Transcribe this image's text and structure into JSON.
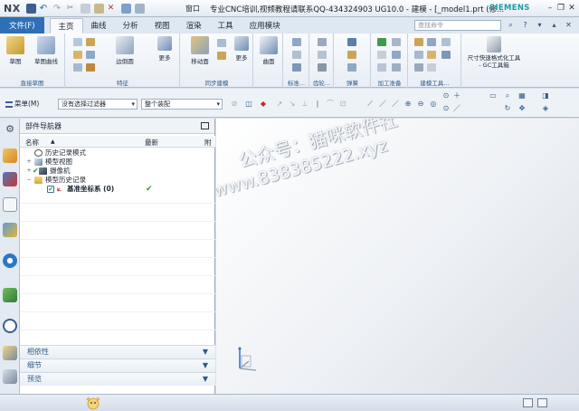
{
  "titlebar": {
    "logo": "NX",
    "window_menu": "窗口",
    "title": "专业CNC培训,视频教程请联系QQ-434324903 UG10.0 - 建模 - [_model1.prt  (修...",
    "brand": "SIEMENS"
  },
  "tabs": {
    "file": "文件(F)",
    "items": [
      "主页",
      "曲线",
      "分析",
      "视图",
      "渲染",
      "工具",
      "应用模块"
    ],
    "active": "主页",
    "search_placeholder": "查找命令"
  },
  "ribbon": {
    "groups": [
      {
        "label": "直接草图",
        "buttons": [
          "草图",
          "草图曲线"
        ]
      },
      {
        "label": "特征",
        "buttons": [
          "边倒圆",
          "更多"
        ]
      },
      {
        "label": "同步建模",
        "buttons": [
          "移动面",
          "更多"
        ]
      },
      {
        "label": "曲面",
        "buttons": [
          "曲面"
        ]
      },
      {
        "label": "标准...",
        "buttons": []
      },
      {
        "label": "齿轮...",
        "buttons": []
      },
      {
        "label": "弹簧",
        "buttons": []
      },
      {
        "label": "加工准备",
        "buttons": []
      },
      {
        "label": "建模工具...",
        "buttons": []
      },
      {
        "label": "",
        "buttons": [
          "尺寸快速格式化工具 - GC工具箱"
        ]
      }
    ]
  },
  "toolbar": {
    "menu": "菜单(M)",
    "filter": "没有选择过滤器",
    "assembly": "整个装配"
  },
  "navigator": {
    "title": "部件导航器",
    "columns": [
      "名称",
      "最新",
      "附"
    ],
    "tree": [
      {
        "label": "历史记录模式",
        "level": 0,
        "latest": ""
      },
      {
        "label": "模型视图",
        "level": 0,
        "latest": ""
      },
      {
        "label": "摄像机",
        "level": 0,
        "latest": ""
      },
      {
        "label": "模型历史记录",
        "level": 0,
        "latest": ""
      },
      {
        "label": "基准坐标系 (0)",
        "level": 1,
        "latest": "✔"
      }
    ],
    "panels": [
      "相依性",
      "细节",
      "预览"
    ]
  },
  "watermark": {
    "line1": "公众号：猫咪软件社",
    "line2": "www.838385222.xyz"
  }
}
